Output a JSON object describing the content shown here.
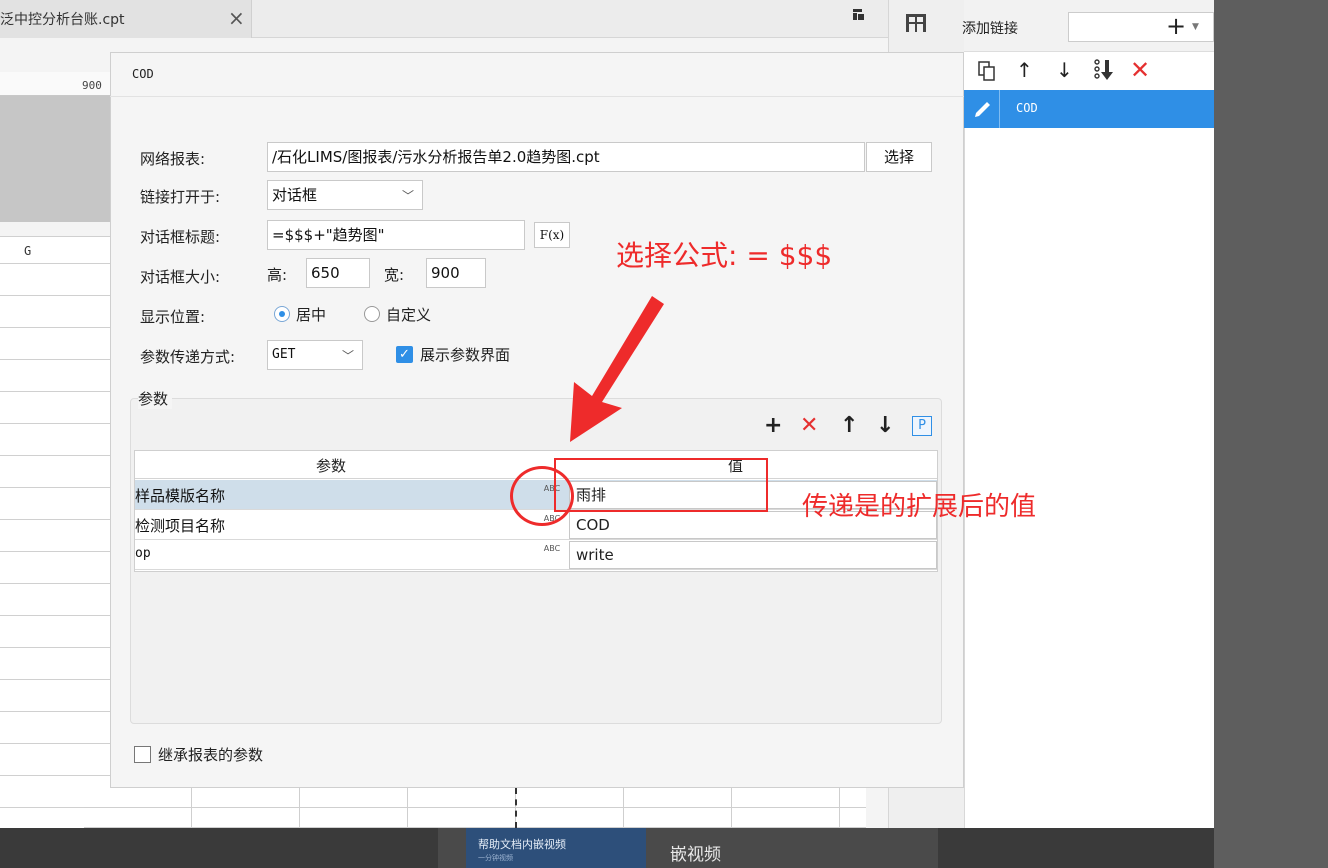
{
  "tab": {
    "title": "泛中控分析台账.cpt",
    "close": "×"
  },
  "ruler": {
    "label": "900"
  },
  "grid": {
    "column_label": "G"
  },
  "right_panel": {
    "title": "添加链接",
    "item_label": "COD"
  },
  "dialog": {
    "title": "COD",
    "report_label": "网络报表:",
    "report_path": "/石化LIMS/图报表/污水分析报告单2.0趋势图.cpt",
    "select_button": "选择",
    "open_in_label": "链接打开于:",
    "open_in_value": "对话框",
    "dialog_title_label": "对话框标题:",
    "dialog_title_value": "=$$$+\"趋势图\"",
    "formula_button": "F(x)",
    "size_label": "对话框大小:",
    "height_label": "高:",
    "height_value": "650",
    "width_label": "宽:",
    "width_value": "900",
    "position_label": "显示位置:",
    "position_center": "居中",
    "position_custom": "自定义",
    "param_method_label": "参数传递方式:",
    "param_method_value": "GET",
    "show_param_ui": "展示参数界面",
    "params_group_label": "参数",
    "table": {
      "header_param": "参数",
      "header_value": "值",
      "type_glyph": "ABC",
      "rows": [
        {
          "name": "样品模版名称",
          "value": "雨排"
        },
        {
          "name": "检测项目名称",
          "value": "COD"
        },
        {
          "name": "op",
          "value": "write"
        }
      ]
    },
    "inherit_params": "继承报表的参数"
  },
  "annotations": {
    "formula_note": "选择公式: = $$$",
    "value_note": "传递是的扩展后的值"
  },
  "bottom": {
    "video_thumb_title": "帮助文档内嵌视频",
    "video_thumb_sub": "一分钟视频",
    "video_caption": "嵌视频"
  },
  "colors": {
    "accent": "#2f8fe6",
    "annotation_red": "#ee2b2b"
  },
  "icons": [
    "close-icon",
    "menu-flag-icon",
    "layout-icon",
    "plus-icon",
    "copy-icon",
    "arrow-up-icon",
    "arrow-down-icon",
    "move-bottom-icon",
    "delete-icon",
    "edit-icon",
    "chevron-down-icon",
    "formula-icon",
    "parameter-icon"
  ]
}
